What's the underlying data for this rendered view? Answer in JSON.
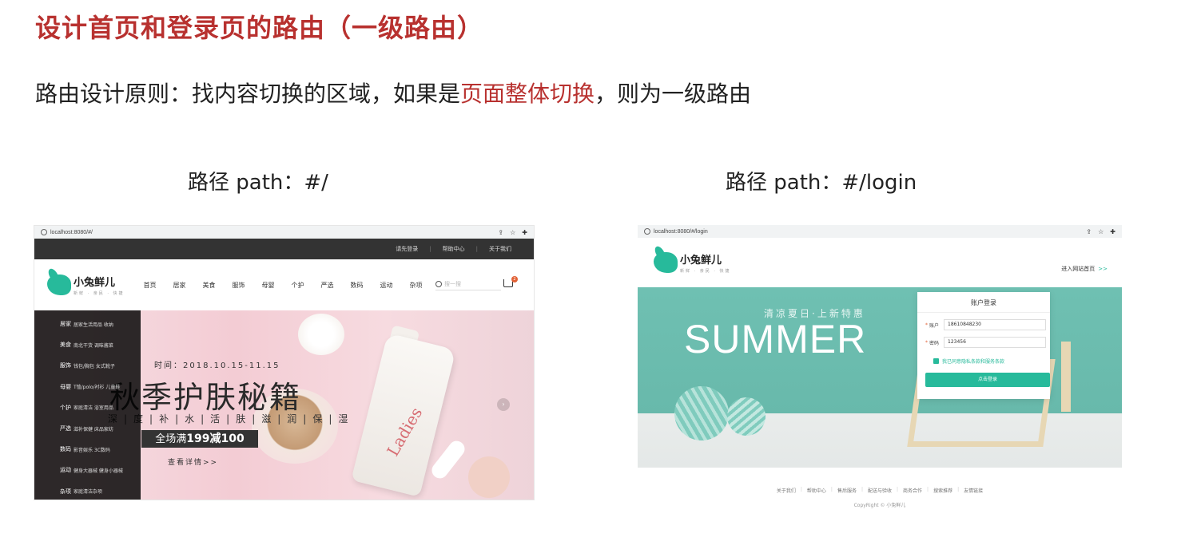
{
  "slide": {
    "title": "设计首页和登录页的路由（一级路由）",
    "principle_prefix": "路由设计原则：找内容切换的区域，如果是",
    "principle_highlight": "页面整体切换",
    "principle_suffix": "，则为一级路由",
    "path_home": "路径 path：#/",
    "path_login": "路径 path：#/login",
    "accent_color": "#b8312f"
  },
  "home": {
    "url": "localhost:8080/#/",
    "toolbar_icons": [
      "share-icon",
      "star-icon",
      "extension-icon"
    ],
    "top_links": [
      "请先登录",
      "帮助中心",
      "关于我们"
    ],
    "logo_name": "小兔鲜儿",
    "logo_sub": "新鲜 · 亲民 · 快捷",
    "nav": [
      "首页",
      "居家",
      "美食",
      "服饰",
      "母婴",
      "个护",
      "严选",
      "数码",
      "运动",
      "杂项"
    ],
    "search_placeholder": "搜一搜",
    "cart_count": "2",
    "categories": [
      {
        "name": "居家",
        "sub": "居家生活用品 收纳"
      },
      {
        "name": "美食",
        "sub": "南北干货 调味酱菜"
      },
      {
        "name": "服饰",
        "sub": "钱包/胸包 女式靴子"
      },
      {
        "name": "母婴",
        "sub": "T恤/polo/衬衫 儿童鞋"
      },
      {
        "name": "个护",
        "sub": "家庭清洁 浴室用品"
      },
      {
        "name": "严选",
        "sub": "滋补保健 床品家纺"
      },
      {
        "name": "数码",
        "sub": "影音娱乐 3C数码"
      },
      {
        "name": "运动",
        "sub": "健身大器械 健身小器械"
      },
      {
        "name": "杂项",
        "sub": "家庭清洁杂项"
      }
    ],
    "banner": {
      "date": "时间：2018.10.15-11.15",
      "title": "秋季护肤秘籍",
      "words": "深|度|补|水|活|肤|滋|润|保|湿",
      "deal_prefix": "全场满",
      "deal_amount": "199减100",
      "more": "查看详情>>",
      "bottle_label": "Ladies"
    }
  },
  "login": {
    "url": "localhost:8080/#/login",
    "toolbar_icons": [
      "share-icon",
      "star-icon",
      "extension-icon"
    ],
    "logo_name": "小兔鲜儿",
    "logo_sub": "新鲜 · 亲民 · 快捷",
    "enter_home": "进入网站首页",
    "enter_home_arrow": ">>",
    "banner_sub": "清凉夏日·上新特惠",
    "banner_title": "SUMMER",
    "card_title": "账户登录",
    "account_label": "账户",
    "account_value": "18610848230",
    "password_label": "密码",
    "password_value": "123456",
    "agree_text": "我已同意隐私条款和服务条款",
    "login_button": "点击登录",
    "footer_links": [
      "关于我们",
      "帮助中心",
      "售后服务",
      "配送与验收",
      "商务合作",
      "搜索推荐",
      "友情链接"
    ],
    "copyright": "CopyRight © 小兔鲜儿"
  }
}
